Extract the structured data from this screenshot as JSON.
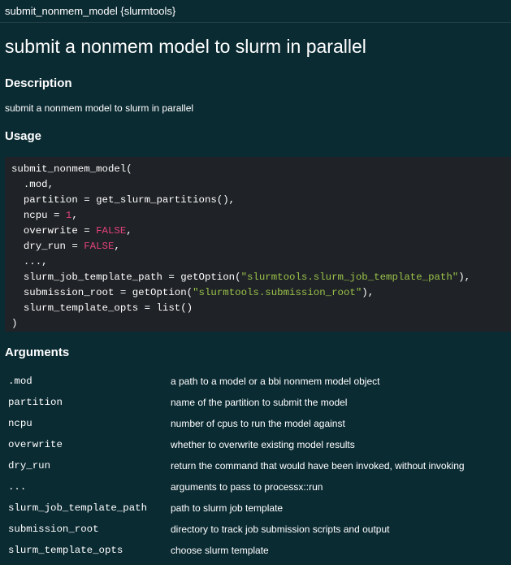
{
  "header": {
    "text": "submit_nonmem_model {slurmtools}"
  },
  "title": "submit a nonmem model to slurm in parallel",
  "description": {
    "heading": "Description",
    "text": "submit a nonmem model to slurm in parallel"
  },
  "usage": {
    "heading": "Usage",
    "lines": [
      [
        {
          "t": "submit_nonmem_model("
        }
      ],
      [
        {
          "t": "  .mod,"
        }
      ],
      [
        {
          "t": "  partition = get_slurm_partitions(),"
        }
      ],
      [
        {
          "t": "  ncpu = "
        },
        {
          "t": "1",
          "c": "num"
        },
        {
          "t": ","
        }
      ],
      [
        {
          "t": "  overwrite = "
        },
        {
          "t": "FALSE",
          "c": "bool"
        },
        {
          "t": ","
        }
      ],
      [
        {
          "t": "  dry_run = "
        },
        {
          "t": "FALSE",
          "c": "bool"
        },
        {
          "t": ","
        }
      ],
      [
        {
          "t": "  ...,"
        }
      ],
      [
        {
          "t": "  slurm_job_template_path = getOption("
        },
        {
          "t": "\"slurmtools.slurm_job_template_path\"",
          "c": "str"
        },
        {
          "t": "),"
        }
      ],
      [
        {
          "t": "  submission_root = getOption("
        },
        {
          "t": "\"slurmtools.submission_root\"",
          "c": "str"
        },
        {
          "t": "),"
        }
      ],
      [
        {
          "t": "  slurm_template_opts = list()"
        }
      ],
      [
        {
          "t": ")"
        }
      ]
    ]
  },
  "arguments": {
    "heading": "Arguments",
    "rows": [
      {
        "name": ".mod",
        "desc": "a path to a model or a bbi nonmem model object"
      },
      {
        "name": "partition",
        "desc": "name of the partition to submit the model"
      },
      {
        "name": "ncpu",
        "desc": "number of cpus to run the model against"
      },
      {
        "name": "overwrite",
        "desc": "whether to overwrite existing model results"
      },
      {
        "name": "dry_run",
        "desc": "return the command that would have been invoked, without invoking"
      },
      {
        "name": "...",
        "desc": "arguments to pass to processx::run"
      },
      {
        "name": "slurm_job_template_path",
        "desc": "path to slurm job template"
      },
      {
        "name": "submission_root",
        "desc": "directory to track job submission scripts and output"
      },
      {
        "name": "slurm_template_opts",
        "desc": "choose slurm template"
      }
    ]
  }
}
